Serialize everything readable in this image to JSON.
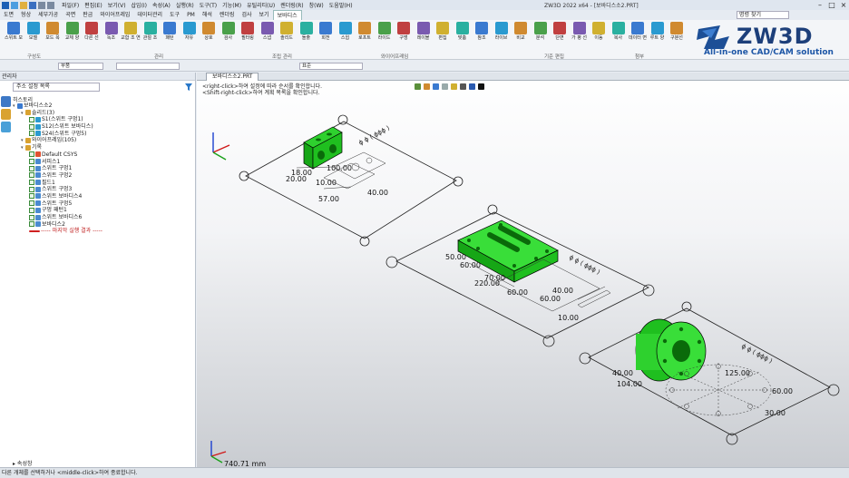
{
  "app": {
    "title": "ZW3D 2022 x64 - [보바디스소2.PRT]",
    "menus": [
      "파일(F)",
      "편집(E)",
      "보기(V)",
      "삽입(I)",
      "속성(A)",
      "실행(R)",
      "도구(T)",
      "기능(M)",
      "유틸리티(U)",
      "렌더링(R)",
      "창(W)",
      "도움말(H)"
    ]
  },
  "tabs": [
    "도면",
    "형상",
    "세부가공",
    "곡면",
    "판금",
    "와이어프레임",
    "데이터관리",
    "도구",
    "PM",
    "해석",
    "렌더링",
    "검사",
    "보기",
    "보바디스"
  ],
  "active_tab": "보바디스",
  "search_placeholder": "명령 찾기",
  "ribbon": {
    "buttons": [
      "스위트 모",
      "모델",
      "보드 목",
      "교체 양",
      "다른 선",
      "독조",
      "교합 조 연",
      "관절 조",
      "패턴",
      "자유",
      "상호",
      "검사",
      "필터링",
      "스냅",
      "솔리드",
      "돌출",
      "회전",
      "스윕",
      "로프트",
      "라이드",
      "구멍",
      "레이블",
      "편집",
      "맞춤",
      "참조",
      "라이브",
      "비교",
      "분석",
      "단면",
      "가 평 선",
      "이동",
      "복사",
      "데이터 면",
      "루트 양",
      "구분선"
    ],
    "groups": [
      "구성도",
      "관리",
      "조립 관리",
      "와이어프레임",
      "기준 편집",
      "첨부"
    ]
  },
  "logo": {
    "name": "ZW3D",
    "tagline": "All-in-one CAD/CAM solution"
  },
  "toolbar2": {
    "filter": "부품",
    "layer": "",
    "view": "표준"
  },
  "panel": {
    "header": "관리자",
    "filter_value": "주소 설정 목록",
    "tree_header": "히스토리",
    "tree": [
      {
        "indent": 0,
        "label": "보바디스소2",
        "icon": "assembly"
      },
      {
        "indent": 1,
        "label": "솔리드(3)",
        "icon": "folder"
      },
      {
        "indent": 2,
        "label": "S1(스위트 구멍1)",
        "icon": "part"
      },
      {
        "indent": 2,
        "label": "S12(스위트 보바디스)",
        "icon": "part"
      },
      {
        "indent": 2,
        "label": "S24(스위트 구멍5)",
        "icon": "part"
      },
      {
        "indent": 1,
        "label": "와이어프레임(105)",
        "icon": "folder"
      },
      {
        "indent": 1,
        "label": "기록",
        "icon": "folder"
      },
      {
        "indent": 2,
        "label": "Default CSYS",
        "icon": "csys"
      },
      {
        "indent": 2,
        "label": "서피스1",
        "icon": "feature"
      },
      {
        "indent": 2,
        "label": "스위트 구멍1",
        "icon": "feature"
      },
      {
        "indent": 2,
        "label": "스위트 구멍2",
        "icon": "feature"
      },
      {
        "indent": 2,
        "label": "필드1",
        "icon": "feature"
      },
      {
        "indent": 2,
        "label": "스위트 구멍3",
        "icon": "feature"
      },
      {
        "indent": 2,
        "label": "스위트 보바디스4",
        "icon": "feature"
      },
      {
        "indent": 2,
        "label": "스위트 구멍5",
        "icon": "feature"
      },
      {
        "indent": 2,
        "label": "구멍 패턴1",
        "icon": "feature"
      },
      {
        "indent": 2,
        "label": "스위트 보바디스6",
        "icon": "feature"
      },
      {
        "indent": 2,
        "label": "보바디스2",
        "icon": "feature"
      },
      {
        "indent": 2,
        "label": "----- 마지막 실행 결과 -----",
        "icon": "marker"
      }
    ],
    "bottom_label": "속성창"
  },
  "viewport": {
    "tab": "보바디스소2.PRT",
    "hint1": "<right-click>하여 설정에 따라 순서를 확인합니다.",
    "hint2": "<Shift-right-click>하여 계획 목록을 확인합니다.",
    "dims_top": [
      "100.00",
      "20.00",
      "40.00",
      "18.00",
      "57.00",
      "10.00"
    ],
    "dims_mid": [
      "50.00",
      "60.00",
      "70.00",
      "220.00",
      "60.00",
      "60.00",
      "40.00",
      "10.00"
    ],
    "dims_bot": [
      "125.00",
      "60.00",
      "30.00",
      "104.00",
      "40.00"
    ],
    "scale": "740.71 mm"
  },
  "status": {
    "text": "다른 개체를 선택하거나 <middle-click>하여 종료합니다."
  },
  "colors": {
    "accent": "#2b63a8",
    "part": "#18c018",
    "ribbon_bg": "#f3f5f8"
  }
}
